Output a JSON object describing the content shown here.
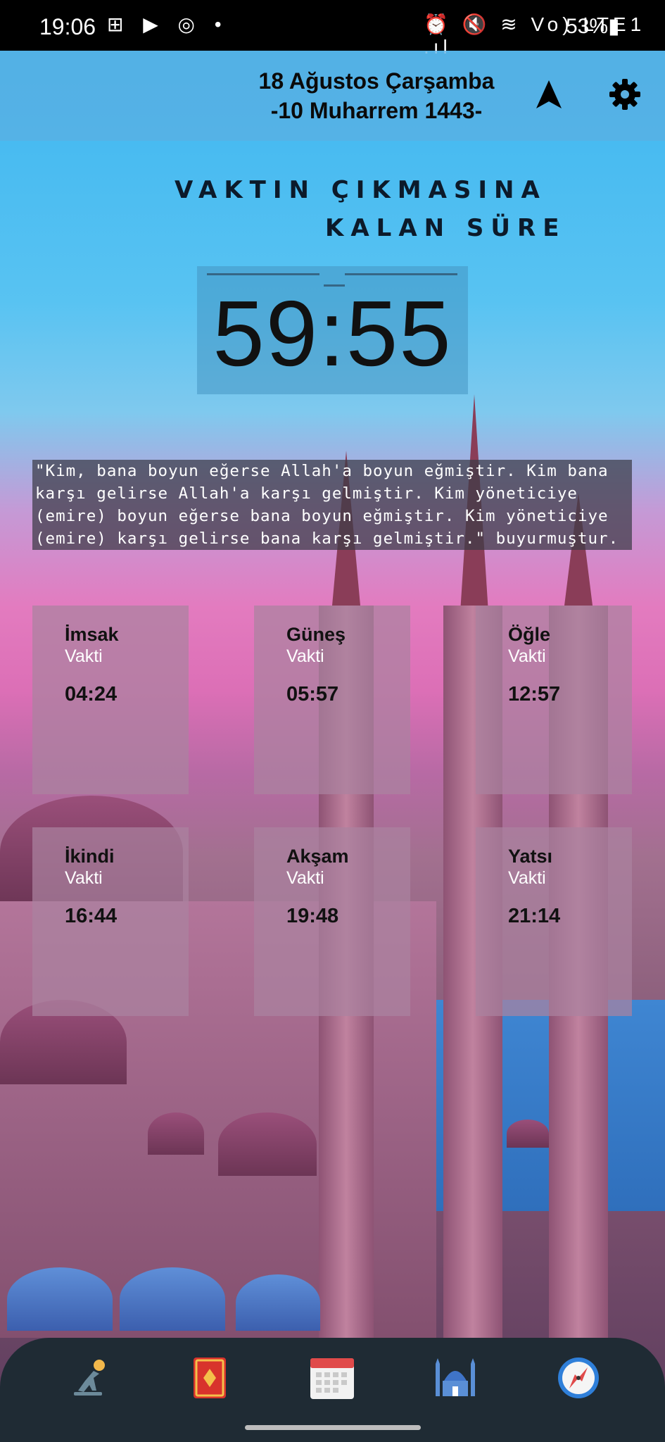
{
  "status_bar": {
    "time": "19:06",
    "left_icons": "⊞ ▶ ◎ •",
    "right_icons": "⏰ 🔇 ≋ Vo) LTE1 .ıl",
    "battery": "53%▮"
  },
  "header": {
    "gregorian_date": "18 Ağustos Çarşamba",
    "hijri_date": "-10 Muharrem 1443-",
    "location_icon": "navigation-arrow",
    "settings_icon": "gear"
  },
  "countdown": {
    "title_line1": "VAKTIN ÇIKMASINA",
    "title_line2": "KALAN SÜRE",
    "value": "59:55"
  },
  "hadith": {
    "text": "\"Kim, bana boyun eğerse Allah'a boyun eğmiştir. Kim bana karşı gelirse Allah'a karşı gelmiştir. Kim yöneticiye (emire) boyun eğerse bana boyun eğmiştir. Kim yöneticiye (emire) karşı gelirse bana karşı gelmiştir.\" buyurmuştur."
  },
  "prayer_times": [
    {
      "name": "İmsak",
      "sub": "Vakti",
      "time": "04:24"
    },
    {
      "name": "Güneş",
      "sub": "Vakti",
      "time": "05:57"
    },
    {
      "name": "Öğle",
      "sub": "Vakti",
      "time": "12:57"
    },
    {
      "name": "İkindi",
      "sub": "Vakti",
      "time": "16:44"
    },
    {
      "name": "Akşam",
      "sub": "Vakti",
      "time": "19:48"
    },
    {
      "name": "Yatsı",
      "sub": "Vakti",
      "time": "21:14"
    }
  ],
  "bottom_nav": [
    "prayer-icon",
    "quran-icon",
    "calendar-icon",
    "mosque-icon",
    "compass-icon"
  ],
  "colors": {
    "header_bg": "#5aafe1",
    "nav_bg": "#1f2b34",
    "card_bg": "#aa82a0",
    "hadith_bg": "#3c3c46"
  }
}
